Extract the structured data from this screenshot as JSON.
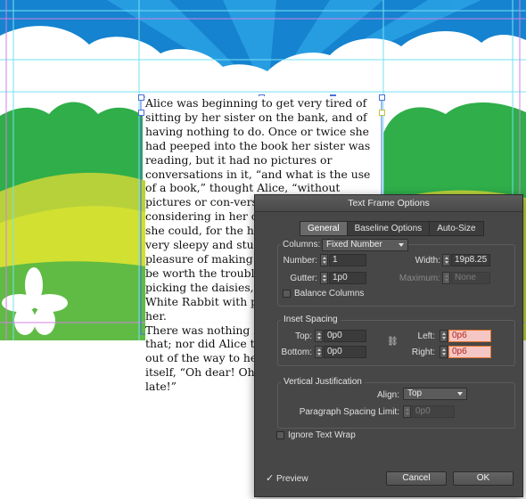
{
  "story": {
    "paragraphs": [
      "Alice was beginning to get very tired of sitting by her sister on the bank, and of having nothing to do. Once or twice she had peeped into the book her sister was reading, but it had no pictures or conversations in it, “and what is the use of a book,” thought Alice, “without pictures or con-versations?” So she was considering in her own mind (as well as she could, for the hot day made her feel very sleepy and stupid), whether the pleasure of making a daisy-chain would be worth the trouble of getting up and picking the daisies, when suddenly a White Rabbit with pink eyes ran close by her.",
      "There was nothing so very remarkable in that; nor did Alice think it so very much out of the way to hear the Rabbit say to itself, “Oh dear! Oh dear! I shall be too late!”"
    ]
  },
  "dialog": {
    "title": "Text Frame Options",
    "tabs": [
      "General",
      "Baseline Options",
      "Auto-Size"
    ],
    "active_tab": "General",
    "columns_label": "Columns:",
    "columns_value": "Fixed Number",
    "number_label": "Number:",
    "number_value": "1",
    "width_label": "Width:",
    "width_value": "19p8.25",
    "gutter_label": "Gutter:",
    "gutter_value": "1p0",
    "maximum_label": "Maximum:",
    "maximum_value": "None",
    "balance_columns_label": "Balance Columns",
    "inset_title": "Inset Spacing",
    "top_label": "Top:",
    "top_value": "0p0",
    "bottom_label": "Bottom:",
    "bottom_value": "0p0",
    "left_label": "Left:",
    "left_value": "0p6",
    "right_label": "Right:",
    "right_value": "0p6",
    "vj_title": "Vertical Justification",
    "align_label": "Align:",
    "align_value": "Top",
    "psl_label": "Paragraph Spacing Limit:",
    "psl_value": "0p0",
    "ignore_wrap_label": "Ignore Text Wrap",
    "preview_label": "Preview",
    "preview_checked": true,
    "cancel_label": "Cancel",
    "ok_label": "OK"
  },
  "colors": {
    "sky_blue": "#1c8fd6",
    "grass_green": "#34b04b",
    "lime": "#c6d92f",
    "dialog_bg": "#474747",
    "inset_highlight": "#f4c6c4"
  }
}
